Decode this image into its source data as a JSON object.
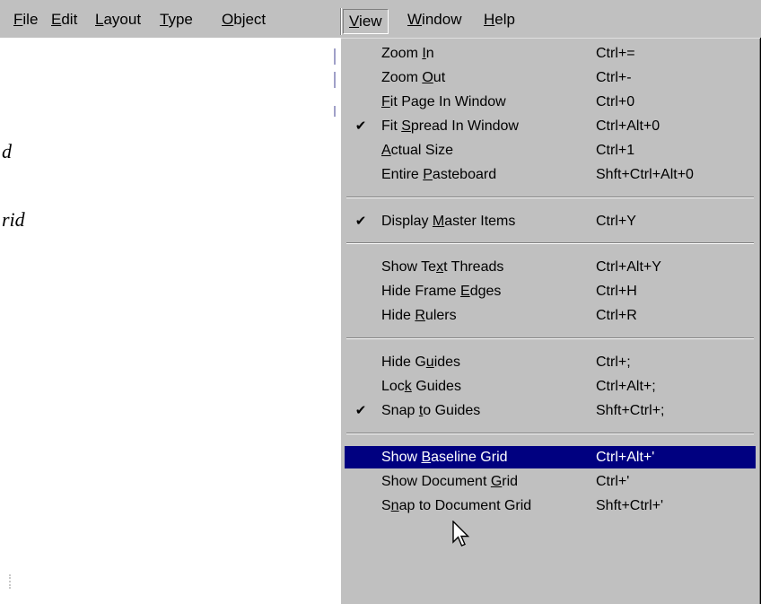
{
  "menubar": {
    "items": [
      {
        "label": "File",
        "ul": "F",
        "rest": "ile"
      },
      {
        "label": "Edit",
        "ul": "E",
        "rest": "dit"
      },
      {
        "label": "Layout",
        "ul": "L",
        "rest": "ayout"
      },
      {
        "label": "Type",
        "ul": "T",
        "rest": "ype"
      },
      {
        "label": "Object",
        "ul": "O",
        "rest": "bject"
      },
      {
        "label": "View",
        "ul": "V",
        "rest": "iew"
      },
      {
        "label": "Window",
        "ul": "W",
        "rest": "indow"
      },
      {
        "label": "Help",
        "ul": "H",
        "rest": "elp"
      }
    ]
  },
  "document": {
    "fragment_1": "d",
    "fragment_2": "rid"
  },
  "view_menu": {
    "items": [
      {
        "pre": "Zoom ",
        "ul": "I",
        "post": "n",
        "shortcut": "Ctrl+=",
        "checked": false
      },
      {
        "pre": "Zoom ",
        "ul": "O",
        "post": "ut",
        "shortcut": "Ctrl+-",
        "checked": false
      },
      {
        "pre": "",
        "ul": "F",
        "post": "it Page In Window",
        "shortcut": "Ctrl+0",
        "checked": false
      },
      {
        "pre": "Fit ",
        "ul": "S",
        "post": "pread In Window",
        "shortcut": "Ctrl+Alt+0",
        "checked": true
      },
      {
        "pre": "",
        "ul": "A",
        "post": "ctual Size",
        "shortcut": "Ctrl+1",
        "checked": false
      },
      {
        "pre": "Entire ",
        "ul": "P",
        "post": "asteboard",
        "shortcut": "Shft+Ctrl+Alt+0",
        "checked": false
      },
      {
        "pre": "Display ",
        "ul": "M",
        "post": "aster Items",
        "shortcut": "Ctrl+Y",
        "checked": true
      },
      {
        "pre": "Show Te",
        "ul": "x",
        "post": "t Threads",
        "shortcut": "Ctrl+Alt+Y",
        "checked": false
      },
      {
        "pre": "Hide Frame ",
        "ul": "E",
        "post": "dges",
        "shortcut": "Ctrl+H",
        "checked": false
      },
      {
        "pre": "Hide ",
        "ul": "R",
        "post": "ulers",
        "shortcut": "Ctrl+R",
        "checked": false
      },
      {
        "pre": "Hide G",
        "ul": "u",
        "post": "ides",
        "shortcut": "Ctrl+;",
        "checked": false
      },
      {
        "pre": "Loc",
        "ul": "k",
        "post": " Guides",
        "shortcut": "Ctrl+Alt+;",
        "checked": false
      },
      {
        "pre": "Snap ",
        "ul": "t",
        "post": "o Guides",
        "shortcut": "Shft+Ctrl+;",
        "checked": true
      },
      {
        "pre": "Show ",
        "ul": "B",
        "post": "aseline Grid",
        "shortcut": "Ctrl+Alt+'",
        "checked": false,
        "highlighted": true
      },
      {
        "pre": "Show Document ",
        "ul": "G",
        "post": "rid",
        "shortcut": "Ctrl+'",
        "checked": false
      },
      {
        "pre": "S",
        "ul": "n",
        "post": "ap to Document Grid",
        "shortcut": "Shft+Ctrl+'",
        "checked": false
      }
    ],
    "check_glyph": "✔"
  },
  "colors": {
    "menu_face": "#c0c0c0",
    "highlight": "#000080"
  }
}
